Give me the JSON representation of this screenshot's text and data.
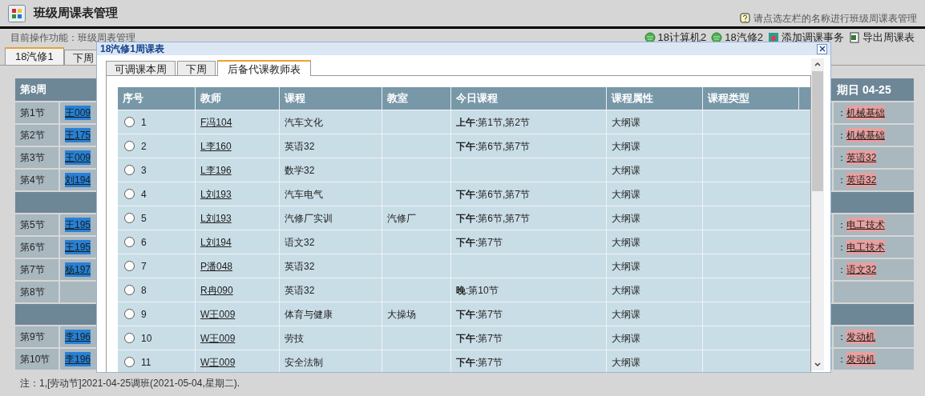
{
  "page": {
    "title": "班级周课表管理",
    "hint": "请点选左栏的名称进行班级周课表管理",
    "current_function": "目前操作功能：班级周表管理",
    "actions": [
      {
        "kind": "class",
        "label": "18计算机2"
      },
      {
        "kind": "class",
        "label": "18汽修2"
      },
      {
        "kind": "add",
        "label": "添加调课事务"
      },
      {
        "kind": "export",
        "label": "导出周课表"
      }
    ]
  },
  "background": {
    "tabs": [
      {
        "label": "18汽修1",
        "selected": true
      },
      {
        "label": "下周",
        "selected": false
      }
    ],
    "week": "第8周",
    "separator": "：",
    "day_header": "期日 04-25",
    "rows": [
      {
        "kind": "lesson",
        "period": "第1节",
        "teacher": "王009",
        "course": "机械基础"
      },
      {
        "kind": "lesson",
        "period": "第2节",
        "teacher": "王175",
        "course": "机械基础"
      },
      {
        "kind": "lesson",
        "period": "第3节",
        "teacher": "王009",
        "course": "英语32"
      },
      {
        "kind": "lesson",
        "period": "第4节",
        "teacher": "刘194",
        "course": "英语32"
      },
      {
        "kind": "break"
      },
      {
        "kind": "lesson",
        "period": "第5节",
        "teacher": "王195",
        "course": "电工技术"
      },
      {
        "kind": "lesson",
        "period": "第6节",
        "teacher": "王195",
        "course": "电工技术"
      },
      {
        "kind": "lesson",
        "period": "第7节",
        "teacher": "杨197",
        "course": "语文32"
      },
      {
        "kind": "lesson",
        "period": "第8节"
      },
      {
        "kind": "break"
      },
      {
        "kind": "lesson",
        "period": "第9节",
        "teacher": "李196",
        "course": "发动机"
      },
      {
        "kind": "lesson",
        "period": "第10节",
        "teacher": "李196",
        "course": "发动机"
      }
    ],
    "note": "注：1,[劳动节]2021-04-25调班(2021-05-04,星期二)."
  },
  "dialog": {
    "title": "18汽修1周课表",
    "tabs": [
      {
        "label": "可调课本周",
        "selected": false
      },
      {
        "label": "下周",
        "selected": false
      },
      {
        "label": "后备代课教师表",
        "selected": true
      }
    ],
    "columns": [
      "序号",
      "教师",
      "课程",
      "教室",
      "今日课程",
      "课程属性",
      "课程类型"
    ],
    "rows": [
      {
        "no": "1",
        "selected": false,
        "teacher": "F冯104",
        "course": "汽车文化",
        "today": "**上午**:第1节,第2节",
        "attribute": "大纲课"
      },
      {
        "no": "2",
        "selected": false,
        "teacher": "L李160",
        "course": "英语32",
        "today": "**下午**:第6节,第7节",
        "attribute": "大纲课"
      },
      {
        "no": "3",
        "selected": false,
        "teacher": "L李196",
        "course": "数学32",
        "attribute": "大纲课"
      },
      {
        "no": "4",
        "selected": false,
        "teacher": "L刘193",
        "course": "汽车电气",
        "today": "**下午**:第6节,第7节",
        "attribute": "大纲课"
      },
      {
        "no": "5",
        "selected": false,
        "teacher": "L刘193",
        "course": "汽修厂实训",
        "room": "汽修厂",
        "today": "**下午**:第6节,第7节",
        "attribute": "大纲课"
      },
      {
        "no": "6",
        "selected": false,
        "teacher": "L刘194",
        "course": "语文32",
        "today": "**下午**:第7节",
        "attribute": "大纲课"
      },
      {
        "no": "7",
        "selected": false,
        "teacher": "P潘048",
        "course": "英语32",
        "attribute": "大纲课"
      },
      {
        "no": "8",
        "selected": false,
        "teacher": "R冉090",
        "course": "英语32",
        "today": "**晚**:第10节",
        "attribute": "大纲课"
      },
      {
        "no": "9",
        "selected": false,
        "teacher": "W王009",
        "course": "体育与健康",
        "room": "大操场",
        "today": "**下午**:第7节",
        "attribute": "大纲课"
      },
      {
        "no": "10",
        "selected": false,
        "teacher": "W王009",
        "course": "劳技",
        "today": "**下午**:第7节",
        "attribute": "大纲课"
      },
      {
        "no": "11",
        "selected": false,
        "teacher": "W王009",
        "course": "安全法制",
        "today": "**下午**:第7节",
        "attribute": "大纲课"
      }
    ]
  }
}
